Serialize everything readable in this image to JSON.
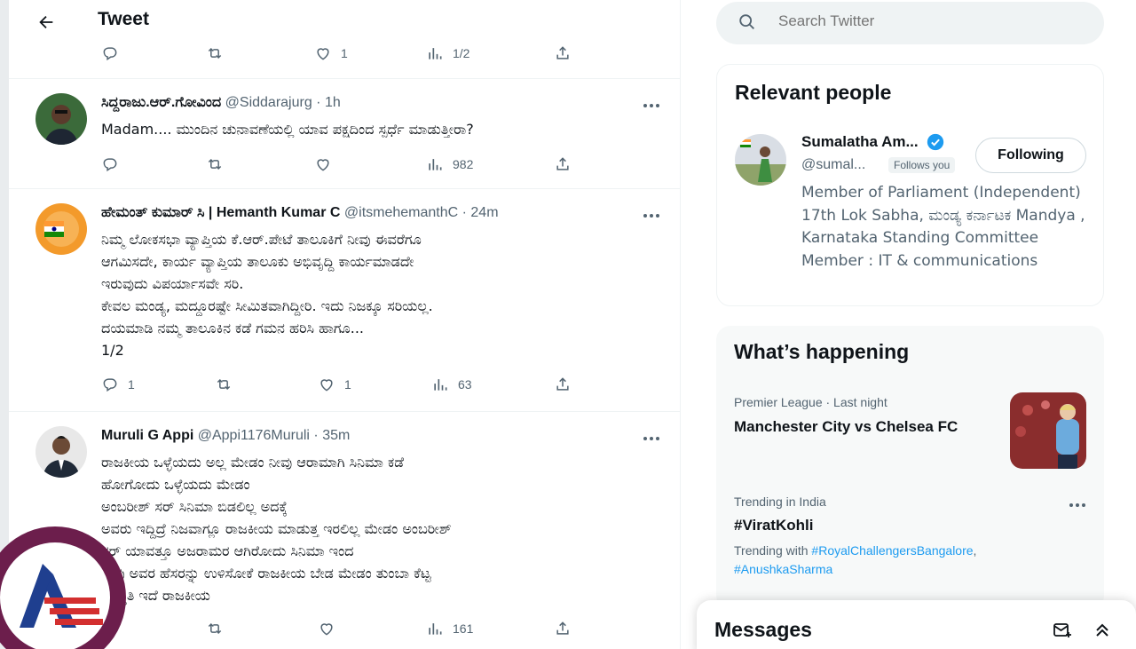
{
  "header": {
    "title": "Tweet"
  },
  "top_actions": {
    "likes": "1",
    "views": "1/2"
  },
  "tweets": [
    {
      "name": "ಸಿದ್ದರಾಜು.ಆರ್.ಗೋವಿಂದ",
      "handle": "@Siddarajurg · 1h",
      "text": "Madam.... ಮುಂದಿನ ಚುನಾವಣೆಯಲ್ಲಿ ಯಾವ ಪಕ್ಷದಿಂದ ಸ್ಪರ್ಧೆ ಮಾಡುತ್ತೀರಾ?",
      "views": "982"
    },
    {
      "name": "ಹೇಮಂತ್ ಕುಮಾರ್ ಸಿ | Hemanth Kumar C",
      "handle": "@itsmehemanthC · 24m",
      "text": "ನಿಮ್ಮ ಲೋಕಸಭಾ ವ್ಯಾಪ್ತಿಯ ಕೆ.ಆರ್.ಪೇಟೆ ತಾಲೂಕಿಗೆ ನೀವು ಈವರೆಗೂ\nಆಗಮಿಸದೇ, ಕಾರ್ಯ ವ್ಯಾಪ್ತಿಯ ತಾಲೂಕು ಅಭಿವೃದ್ದಿ ಕಾರ್ಯಮಾಡದೇ\nಇರುವುದು ವಿಪರ್ಯಾಸವೇ ಸರಿ.\nಕೇವಲ ಮಂಡ್ಯ, ಮದ್ದೂರಷ್ಟೇ ಸೀಮಿತವಾಗಿದ್ದೀರಿ. ಇದು ನಿಜಕ್ಕೂ ಸರಿಯಲ್ಲ.\nದಯಮಾಡಿ ನಮ್ಮ ತಾಲೂಕಿನ ಕಡೆ ಗಮನ ಹರಿಸಿ ಹಾಗೂ...\n1/2",
      "replies": "1",
      "likes": "1",
      "views": "63"
    },
    {
      "name": "Muruli G Appi",
      "handle": "@Appi1176Muruli · 35m",
      "text": "ರಾಜಕೀಯ ಒಳ್ಳೆಯದು ಅಲ್ಲ ಮೇಡಂ ನೀವು ಆರಾಮಾಗಿ ಸಿನಿಮಾ ಕಡೆ\nಹೋಗೋದು ಒಳ್ಳೆಯದು ಮೇಡಂ\nಅಂಬರೀಶ್ ಸರ್ ಸಿನಿಮಾ ಬಿಡಲಿಲ್ಲ ಅದಕ್ಕೆ\nಅವರು ಇದ್ದಿದ್ರೆ ನಿಜವಾಗ್ಲೂ ರಾಜಕೀಯ ಮಾಡುತ್ತ ಇರಲಿಲ್ಲ ಮೇಡಂ ಅಂಬರೀಶ್\nಸರ್ ಯಾವತ್ತೂ ಅಜರಾಮರ ಆಗಿರೋದು ಸಿನಿಮಾ ಇಂದ\nನೀವು ಅವರ ಹೆಸರನ್ನು ಉಳಿಸೋಕೆ ರಾಜಕೀಯ ಬೇಡ ಮೇಡಂ ತುಂಬಾ ಕೆಟ್ಟ\nಪರಿಸ್ಥಿತಿ ಇದೆ ರಾಜಕೀಯ",
      "views": "161"
    }
  ],
  "search": {
    "placeholder": "Search Twitter"
  },
  "relevant_people": {
    "title": "Relevant people",
    "name": "Sumalatha Am...",
    "handle": "@sumal...",
    "follows_you": "Follows you",
    "button": "Following",
    "bio": "Member of Parliament (Independent) 17th Lok Sabha, ಮಂಡ್ಯ ಕರ್ನಾಟಕ Mandya , Karnataka Standing Committee Member : IT & communications"
  },
  "happening": {
    "title": "What’s happening",
    "trend1_meta": "Premier League · Last night",
    "trend1_title": "Manchester City vs Chelsea FC",
    "trend2_meta": "Trending in India",
    "trend2_title": "#ViratKohli",
    "trend2_with_prefix": "Trending with",
    "trend2_tag1": "#RoyalChallengersBangalore",
    "trend2_tag2": "#AnushkaSharma"
  },
  "messages": {
    "title": "Messages"
  },
  "colors": {
    "accent": "#1d9bf0",
    "watermark": "#6c1e4c",
    "text": "#0f1419",
    "muted": "#536471"
  }
}
